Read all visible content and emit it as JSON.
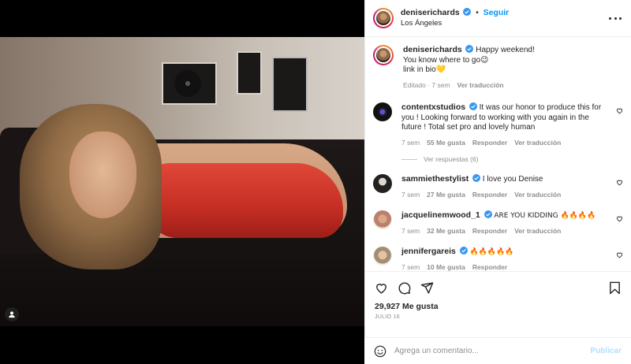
{
  "post": {
    "username": "deniserichards",
    "follow_label": "Seguir",
    "location": "Los Ángeles",
    "caption_lines": [
      "Happy weekend!",
      "You know where to go😉",
      "link in bio💛"
    ],
    "caption_meta": "Editado · 7 sem",
    "see_translation": "Ver traducción",
    "likes": "29,927 Me gusta",
    "date": "JULIO 16"
  },
  "comments": [
    {
      "username": "contentxstudios",
      "text": "It was our honor to produce this for you ! Looking forward to working with you again in the future ! Total set pro and lovely human",
      "time": "7 sem",
      "likes": "55 Me gusta",
      "reply": "Responder",
      "translate": "Ver traducción",
      "replies_label": "Ver respuestas (6)"
    },
    {
      "username": "sammiethestylist",
      "text": "I love you Denise",
      "time": "7 sem",
      "likes": "27 Me gusta",
      "reply": "Responder",
      "translate": "Ver traducción"
    },
    {
      "username": "jacquelinemwood_1",
      "text": "ARE YOU KIDDING 🔥🔥🔥🔥",
      "time": "7 sem",
      "likes": "32 Me gusta",
      "reply": "Responder",
      "translate": "Ver traducción"
    },
    {
      "username": "jennifergareis",
      "text": "🔥🔥🔥🔥🔥",
      "time": "7 sem",
      "likes": "10 Me gusta",
      "reply": "Responder"
    }
  ],
  "comment_box": {
    "placeholder": "Agrega un comentario...",
    "publish_label": "Publicar"
  },
  "colors": {
    "follow_blue": "#0095f6",
    "publish_disabled": "#b2dffc",
    "verified_blue": "#3897f0"
  },
  "icons": [
    "user-tag-icon",
    "more-options-icon",
    "verified-icon",
    "heart-icon",
    "comment-icon",
    "share-icon",
    "bookmark-icon",
    "emoji-icon"
  ]
}
